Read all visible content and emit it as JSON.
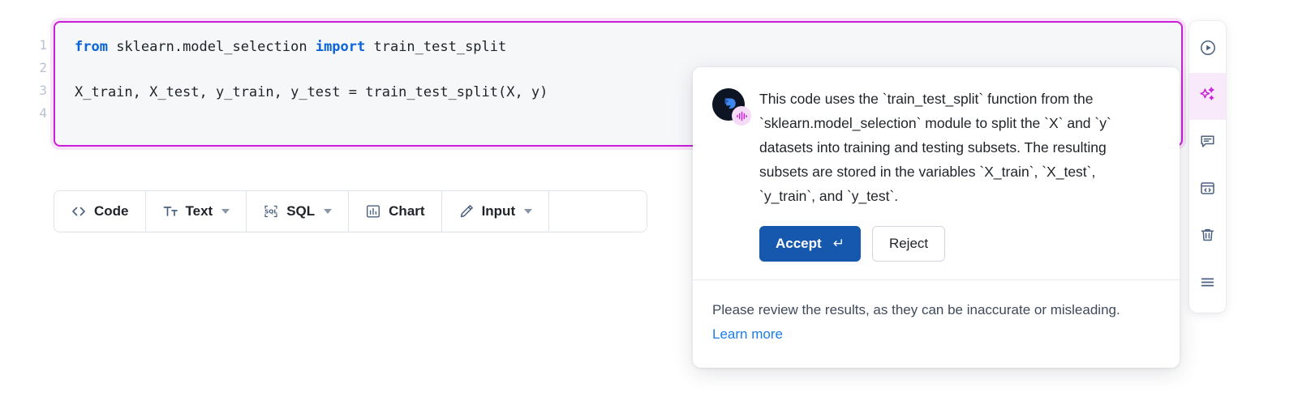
{
  "editor": {
    "line_numbers": [
      "1",
      "2",
      "3",
      "4"
    ],
    "code_lines": [
      {
        "tokens": [
          {
            "t": "from",
            "k": true
          },
          {
            "t": " sklearn.model_selection ",
            "k": false
          },
          {
            "t": "import",
            "k": true
          },
          {
            "t": " train_test_split",
            "k": false
          }
        ]
      },
      {
        "tokens": [
          {
            "t": "",
            "k": false
          }
        ]
      },
      {
        "tokens": [
          {
            "t": "X_train, X_test, y_train, y_test = train_test_split(X, y)",
            "k": false
          }
        ]
      }
    ],
    "border_color": "#c91fd8",
    "background": "#f6f7f9"
  },
  "toolbar": {
    "items": [
      {
        "label": "Code",
        "icon": "angle-brackets-icon",
        "has_caret": false
      },
      {
        "label": "Text",
        "icon": "text-format-icon",
        "has_caret": true
      },
      {
        "label": "SQL",
        "icon": "sql-icon",
        "has_caret": true
      },
      {
        "label": "Chart",
        "icon": "bar-chart-icon",
        "has_caret": false
      },
      {
        "label": "Input",
        "icon": "pencil-icon",
        "has_caret": true
      }
    ]
  },
  "ai_popup": {
    "avatar_icon": "assistant-avatar-icon",
    "badge_icon": "audio-waveform-icon",
    "message": "This code uses the `train_test_split` function from the `sklearn.model_selection` module to split the `X` and `y` datasets into training and testing subsets. The resulting subsets are stored in the variables `X_train`, `X_test`, `y_train`, and `y_test`.",
    "accept_label": "Accept",
    "accept_shortcut": "↵",
    "accept_color": "#1558ae",
    "reject_label": "Reject",
    "disclaimer": "Please review the results, as they can be inaccurate or misleading.",
    "learn_more_label": "Learn more",
    "learn_more_color": "#1a7ced"
  },
  "rail": {
    "items": [
      {
        "icon": "play-circle-icon",
        "active": false
      },
      {
        "icon": "sparkles-icon",
        "active": true
      },
      {
        "icon": "comment-icon",
        "active": false
      },
      {
        "icon": "code-window-icon",
        "active": false
      },
      {
        "icon": "trash-icon",
        "active": false
      },
      {
        "icon": "menu-icon",
        "active": false
      }
    ],
    "active_color": "#c91fd8"
  }
}
